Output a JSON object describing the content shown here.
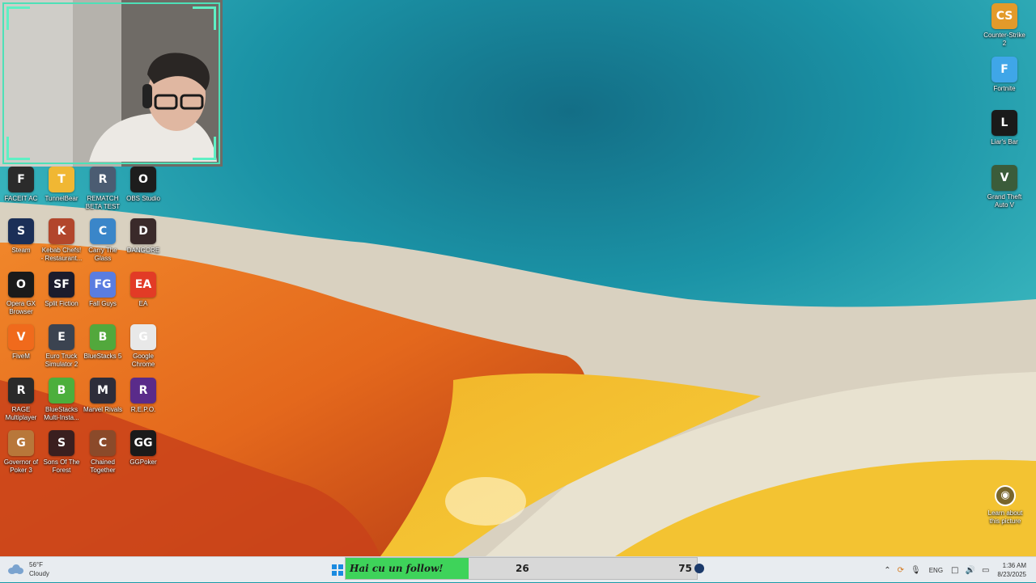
{
  "desktop": {
    "left_icons": [
      {
        "label": "FACEIT AC",
        "icon": "faceit-icon",
        "color": "#2b2b2b",
        "glyph": "F"
      },
      {
        "label": "TunnelBear",
        "icon": "bear-icon",
        "color": "#f0b733",
        "glyph": "T"
      },
      {
        "label": "REMATCH BETA TEST",
        "icon": "rematch-icon",
        "color": "#4b5c72",
        "glyph": "R"
      },
      {
        "label": "OBS Studio",
        "icon": "obs-icon",
        "color": "#1d1d1d",
        "glyph": "O"
      },
      {
        "label": "Steam",
        "icon": "steam-icon",
        "color": "#1b2f57",
        "glyph": "S"
      },
      {
        "label": "Kebab Chefs! - Restaurant...",
        "icon": "kebab-icon",
        "color": "#b2462c",
        "glyph": "K"
      },
      {
        "label": "Carry The Glass",
        "icon": "carry-glass-icon",
        "color": "#3a86c9",
        "glyph": "C"
      },
      {
        "label": "DANGORE",
        "icon": "dangore-icon",
        "color": "#3a2a2a",
        "glyph": "D"
      },
      {
        "label": "Opera GX Browser",
        "icon": "opera-gx-icon",
        "color": "#1a1a1a",
        "glyph": "O"
      },
      {
        "label": "Split Fiction",
        "icon": "split-fiction-icon",
        "color": "#1c1c2c",
        "glyph": "SF"
      },
      {
        "label": "Fall Guys",
        "icon": "fall-guys-icon",
        "color": "#5a7de0",
        "glyph": "FG"
      },
      {
        "label": "EA",
        "icon": "ea-icon",
        "color": "#e23b26",
        "glyph": "EA"
      },
      {
        "label": "FiveM",
        "icon": "fivem-icon",
        "color": "#f06a1c",
        "glyph": "V"
      },
      {
        "label": "Euro Truck Simulator 2",
        "icon": "ets2-icon",
        "color": "#3b4350",
        "glyph": "E"
      },
      {
        "label": "BlueStacks 5",
        "icon": "bluestacks-icon",
        "color": "#52a83c",
        "glyph": "B"
      },
      {
        "label": "Google Chrome",
        "icon": "chrome-icon",
        "color": "#e8e8e8",
        "glyph": "G"
      },
      {
        "label": "RAGE Multiplayer",
        "icon": "rage-icon",
        "color": "#2a2a2a",
        "glyph": "R"
      },
      {
        "label": "BlueStacks Multi-Insta...",
        "icon": "bluestacks-multi-icon",
        "color": "#4caf3c",
        "glyph": "B"
      },
      {
        "label": "Marvel Rivals",
        "icon": "marvel-rivals-icon",
        "color": "#2d2d3a",
        "glyph": "M"
      },
      {
        "label": "R.E.P.O.",
        "icon": "repo-icon",
        "color": "#5a2b8a",
        "glyph": "R"
      },
      {
        "label": "Governor of Poker 3",
        "icon": "poker-icon",
        "color": "#b8773a",
        "glyph": "G"
      },
      {
        "label": "Sons Of The Forest",
        "icon": "sons-forest-icon",
        "color": "#3a1f1f",
        "glyph": "S"
      },
      {
        "label": "Chained Together",
        "icon": "chained-icon",
        "color": "#8b4a2a",
        "glyph": "C"
      },
      {
        "label": "GGPoker",
        "icon": "ggpoker-icon",
        "color": "#1a1a1a",
        "glyph": "GG"
      }
    ],
    "right_icons": [
      {
        "label": "Counter-Strike 2",
        "icon": "cs2-icon",
        "color": "#e39a2a",
        "glyph": "CS"
      },
      {
        "label": "Fortnite",
        "icon": "fortnite-icon",
        "color": "#3fa6e8",
        "glyph": "F"
      },
      {
        "label": "Liar's Bar",
        "icon": "liars-bar-icon",
        "color": "#1a1a1a",
        "glyph": "L"
      },
      {
        "label": "Grand Theft Auto V",
        "icon": "gta5-icon",
        "color": "#3b5c3a",
        "glyph": "V"
      }
    ],
    "learn_label": "Learn about this picture"
  },
  "taskbar": {
    "weather_temp": "56°F",
    "weather_desc": "Cloudy",
    "follow_text": "Hai cu un follow!",
    "follow_current": "26",
    "follow_goal": "75",
    "follow_progress": 0.35,
    "language": "ENG",
    "time": "1:36 AM",
    "date": "8/23/2025"
  }
}
